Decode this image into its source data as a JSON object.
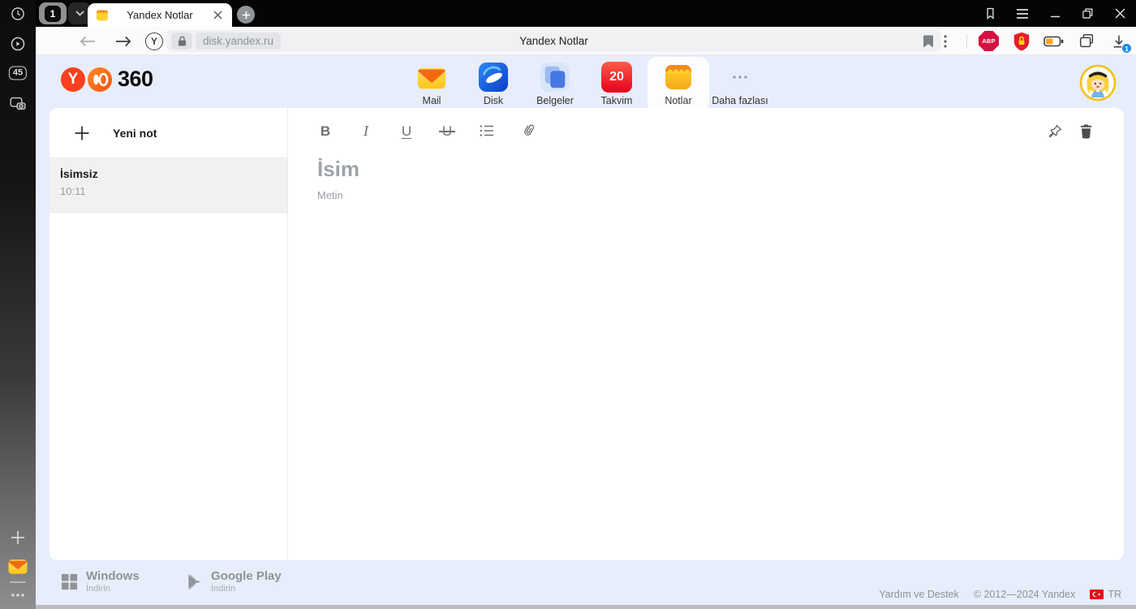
{
  "browser": {
    "sidebar": {
      "badge_45": "45"
    },
    "tabbar": {
      "tab_count": "1",
      "tab_title": "Yandex Notlar"
    },
    "toolbar": {
      "yandex_button": "Y",
      "domain": "disk.yandex.ru",
      "page_title": "Yandex Notlar",
      "abp_label": "ABP",
      "download_badge": "1"
    }
  },
  "header": {
    "logo_y": "Y",
    "logo_360": "360",
    "apps": [
      {
        "label": "Mail"
      },
      {
        "label": "Disk"
      },
      {
        "label": "Belgeler"
      },
      {
        "label": "Takvim",
        "badge": "20"
      },
      {
        "label": "Notlar"
      },
      {
        "label": "Daha fazlası"
      }
    ]
  },
  "notes_panel": {
    "new_note_label": "Yeni not",
    "notes": [
      {
        "title": "İsimsiz",
        "time": "10:11"
      }
    ]
  },
  "editor": {
    "toolbar": {
      "bold": "B",
      "italic": "I",
      "underline": "U",
      "strikethrough": "U"
    },
    "title_placeholder": "İsim",
    "body_placeholder": "Metin"
  },
  "footer": {
    "windows": {
      "title": "Windows",
      "subtitle": "İndirin"
    },
    "google_play": {
      "title": "Google Play",
      "subtitle": "İndirin"
    },
    "help": "Yardım ve Destek",
    "copyright": "© 2012—2024 Yandex",
    "lang": "TR"
  },
  "colors": {
    "page_background": "#e7edfa",
    "brand_red": "#fc3f1d",
    "notes_yellow": "#ffd12e",
    "calendar_red": "#e6001e",
    "download_badge_blue": "#1e88e5"
  }
}
